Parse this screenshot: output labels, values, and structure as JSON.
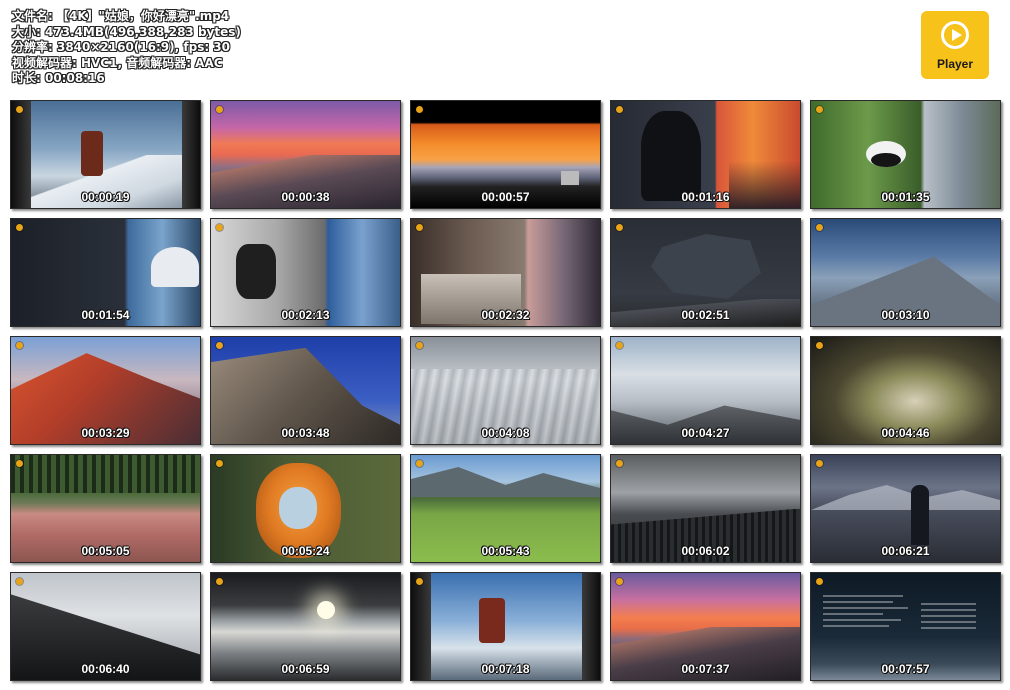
{
  "file_info": {
    "name_line": "文件名: 【4K】\"姑娘，你好漂亮\".mp4",
    "size_line": "大小: 473.4MB(496,388,283 bytes)",
    "resolution_line": "分辨率: 3840×2160(16:9), fps: 30",
    "codec_line": "视频解码器: HVC1, 音频解码器: AAC",
    "duration_line": "时长: 00:08:16"
  },
  "player_badge": {
    "label": "Player",
    "color": "#f7c21a",
    "icon": "play-circle-icon"
  },
  "thumbnails": [
    {
      "timestamp": "00:00:19"
    },
    {
      "timestamp": "00:00:38"
    },
    {
      "timestamp": "00:00:57"
    },
    {
      "timestamp": "00:01:16"
    },
    {
      "timestamp": "00:01:35"
    },
    {
      "timestamp": "00:01:54"
    },
    {
      "timestamp": "00:02:13"
    },
    {
      "timestamp": "00:02:32"
    },
    {
      "timestamp": "00:02:51"
    },
    {
      "timestamp": "00:03:10"
    },
    {
      "timestamp": "00:03:29"
    },
    {
      "timestamp": "00:03:48"
    },
    {
      "timestamp": "00:04:08"
    },
    {
      "timestamp": "00:04:27"
    },
    {
      "timestamp": "00:04:46"
    },
    {
      "timestamp": "00:05:05"
    },
    {
      "timestamp": "00:05:24"
    },
    {
      "timestamp": "00:05:43"
    },
    {
      "timestamp": "00:06:02"
    },
    {
      "timestamp": "00:06:21"
    },
    {
      "timestamp": "00:06:40"
    },
    {
      "timestamp": "00:06:59"
    },
    {
      "timestamp": "00:07:18"
    },
    {
      "timestamp": "00:07:37"
    },
    {
      "timestamp": "00:07:57"
    }
  ]
}
